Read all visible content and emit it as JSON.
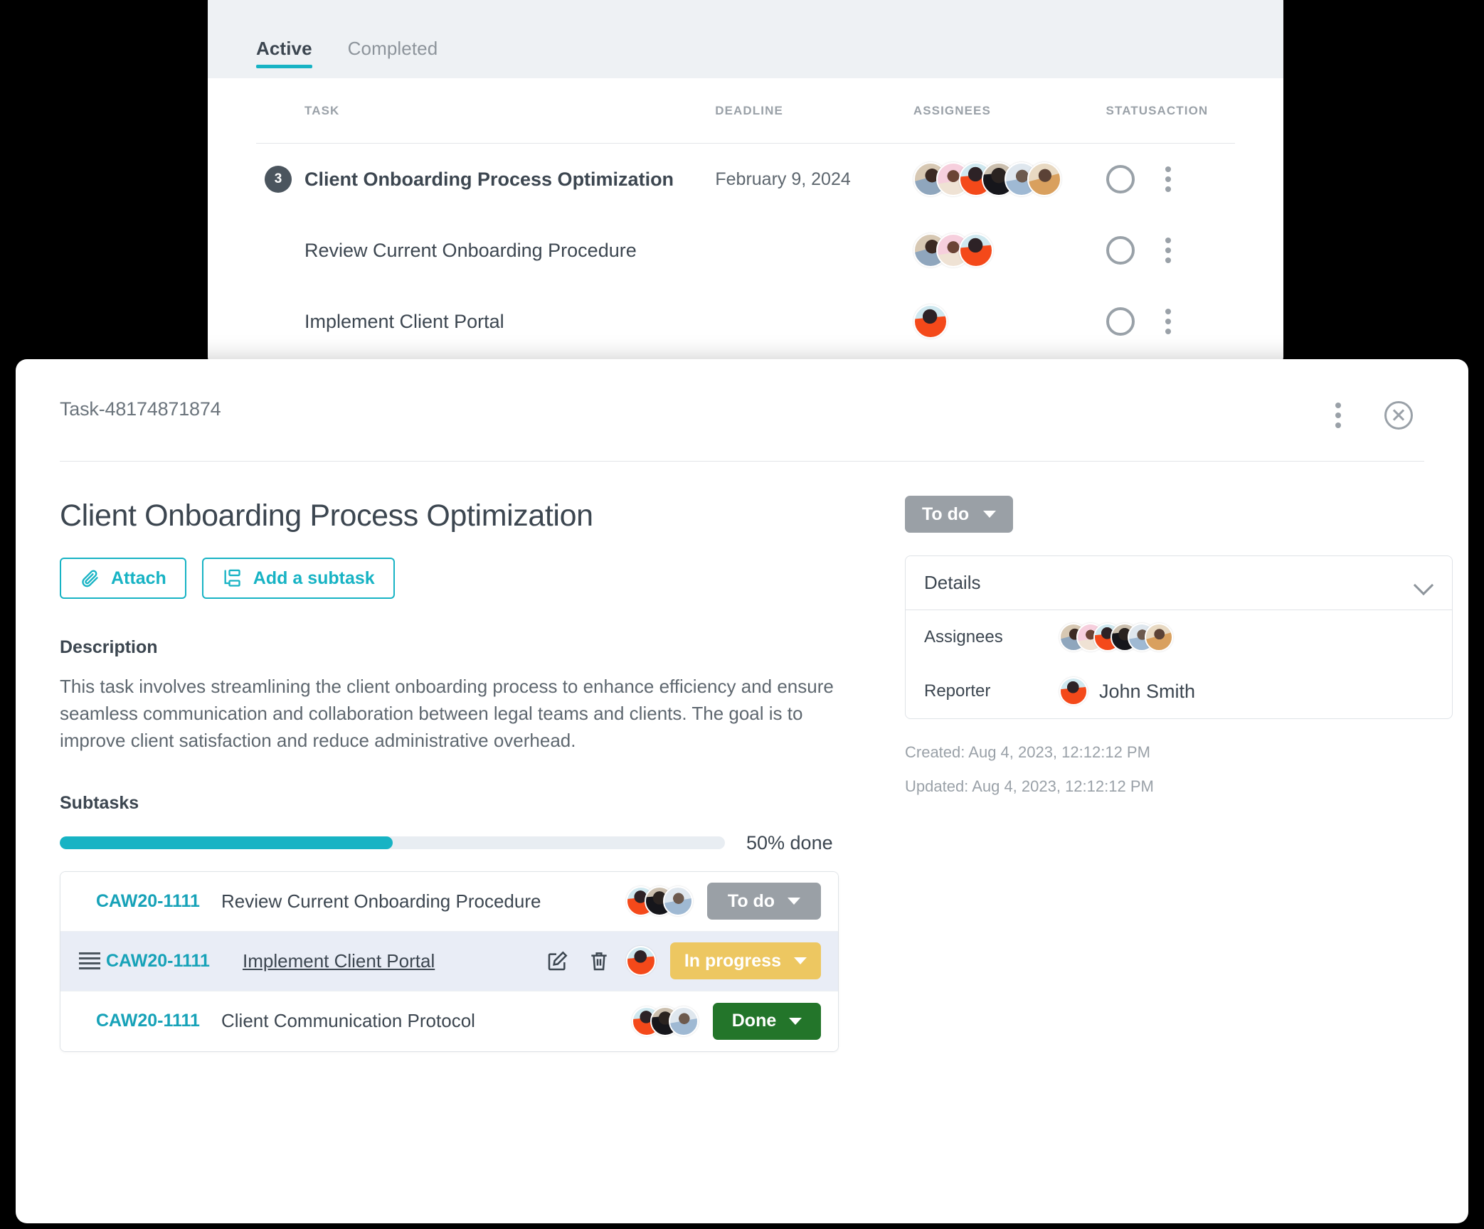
{
  "background_panel": {
    "tabs": [
      {
        "label": "Active",
        "active": true
      },
      {
        "label": "Completed",
        "active": false
      }
    ],
    "columns": [
      "TASK",
      "DEADLINE",
      "ASSIGNEES",
      "STATUS",
      "ACTION"
    ],
    "rows": [
      {
        "count_badge": "3",
        "task": "Client Onboarding Process Optimization",
        "deadline": "February 9, 2024",
        "assignee_count": 6,
        "status": "open",
        "action": "more-options"
      },
      {
        "count_badge": "",
        "task": "Review Current Onboarding Procedure",
        "deadline": "",
        "assignee_count": 3,
        "status": "open",
        "action": "more-options"
      },
      {
        "count_badge": "",
        "task": "Implement Client Portal",
        "deadline": "",
        "assignee_count": 1,
        "status": "open",
        "action": "more-options"
      }
    ]
  },
  "modal": {
    "task_id": "Task-48174871874",
    "header_icons": {
      "menu": "more-options-icon",
      "close": "close-icon"
    },
    "title": "Client Onboarding Process Optimization",
    "buttons": [
      {
        "label": "Attach",
        "icon": "paperclip-icon"
      },
      {
        "label": "Add a subtask",
        "icon": "subtask-icon"
      }
    ],
    "description_heading": "Description",
    "description": "This task involves streamlining the client onboarding process to enhance efficiency and ensure seamless communication and collaboration between legal teams and clients. The goal is to improve client satisfaction and reduce administrative overhead.",
    "subtasks_heading": "Subtasks",
    "progress": {
      "percent": 50,
      "label": "50% done"
    },
    "subtasks": [
      {
        "key": "CAW20-1111",
        "name": "Review Current Onboarding Procedure",
        "status": "To do",
        "status_kind": "todo",
        "assignee_count": 3,
        "highlighted": false,
        "underlined": false,
        "show_row_icons": false
      },
      {
        "key": "CAW20-1111",
        "name": "Implement Client Portal",
        "status": "In progress",
        "status_kind": "prog",
        "assignee_count": 1,
        "highlighted": true,
        "underlined": true,
        "show_row_icons": true
      },
      {
        "key": "CAW20-1111",
        "name": "Client Communication Protocol",
        "status": "Done",
        "status_kind": "done",
        "assignee_count": 3,
        "highlighted": false,
        "underlined": false,
        "show_row_icons": false
      }
    ],
    "sidebar": {
      "status_selected": "To do",
      "details_label": "Details",
      "assignees_label": "Assignees",
      "assignees_count": 6,
      "reporter_label": "Reporter",
      "reporter_name": "John Smith",
      "created": "Created: Aug 4, 2023, 12:12:12 PM",
      "updated": "Updated: Aug 4, 2023, 12:12:12 PM"
    }
  },
  "colors": {
    "accent": "#17b3c4",
    "link": "#17a2b8",
    "status_todo": "#9aa0a6",
    "status_inprogress": "#edc761",
    "status_done": "#23752a",
    "text_dark": "#3c4650",
    "text_muted": "#8d949b",
    "row_highlight": "#e9edf6"
  }
}
